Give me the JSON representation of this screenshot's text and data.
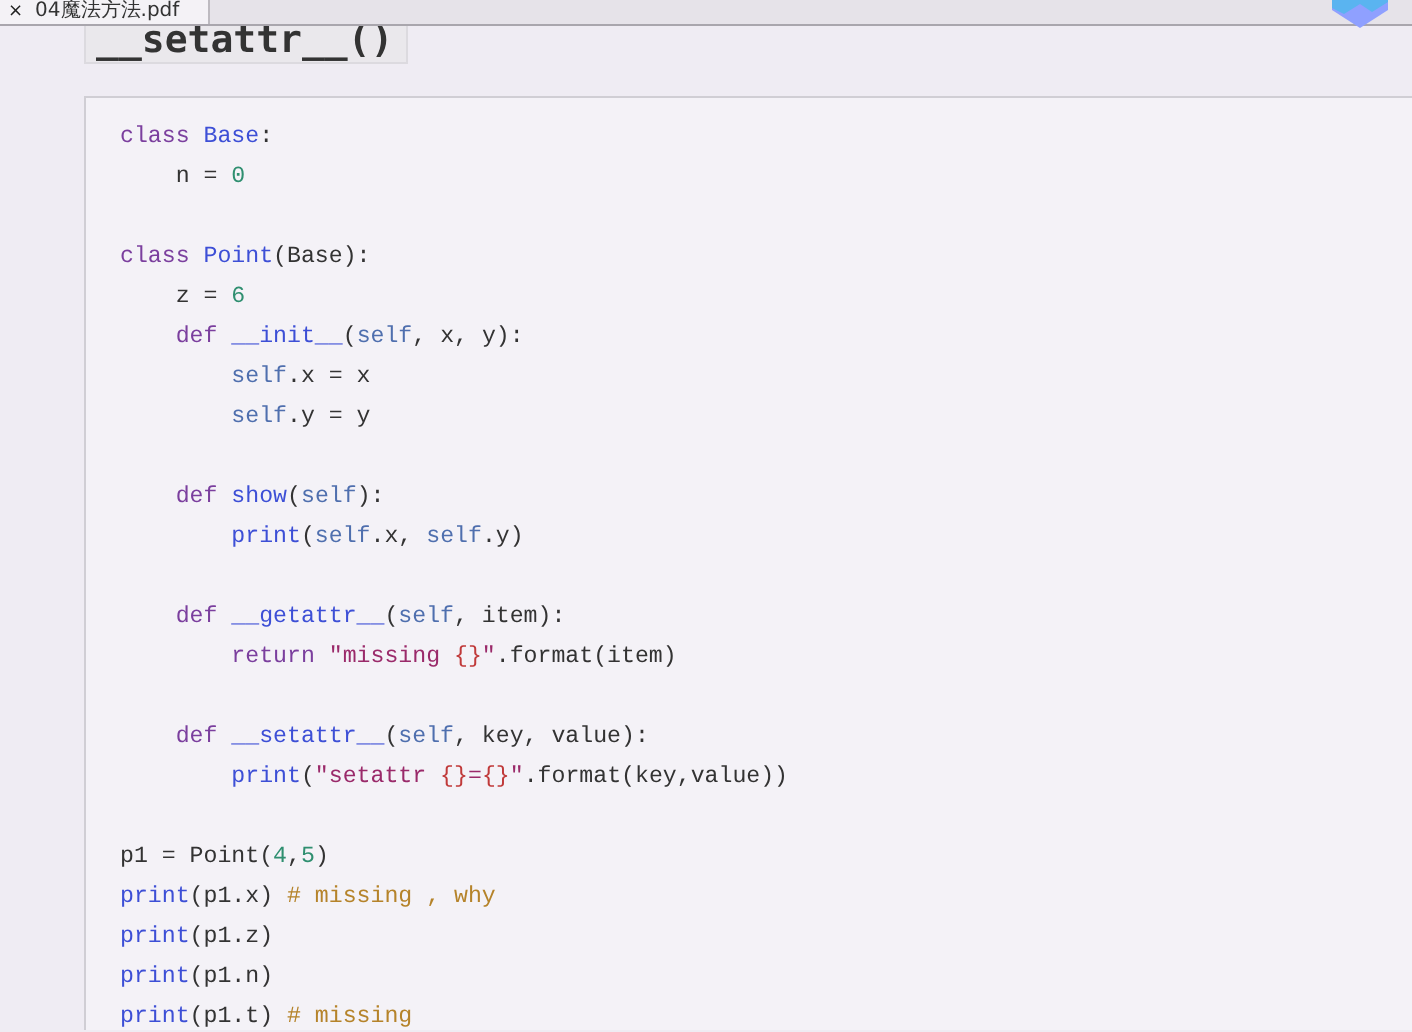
{
  "tab": {
    "close": "×",
    "label": "04魔法方法.pdf"
  },
  "heading": "__setattr__()",
  "code_blocks": [
    [
      [
        {
          "t": "class ",
          "kind": "kw"
        },
        {
          "t": "Base",
          "kind": "cls"
        },
        {
          "t": ":",
          "kind": "p"
        }
      ],
      [
        {
          "t": "    n = ",
          "kind": "p"
        },
        {
          "t": "0",
          "kind": "num"
        }
      ]
    ],
    [
      [
        {
          "t": "class ",
          "kind": "kw"
        },
        {
          "t": "Point",
          "kind": "cls"
        },
        {
          "t": "(Base):",
          "kind": "p"
        }
      ],
      [
        {
          "t": "    z = ",
          "kind": "p"
        },
        {
          "t": "6",
          "kind": "num"
        }
      ],
      [
        {
          "t": "    def ",
          "kind": "kw"
        },
        {
          "t": "__init__",
          "kind": "fn"
        },
        {
          "t": "(",
          "kind": "p"
        },
        {
          "t": "self",
          "kind": "self"
        },
        {
          "t": ", x, y):",
          "kind": "p"
        }
      ],
      [
        {
          "t": "        self",
          "kind": "self"
        },
        {
          "t": ".x = x",
          "kind": "p"
        }
      ],
      [
        {
          "t": "        self",
          "kind": "self"
        },
        {
          "t": ".y = y",
          "kind": "p"
        }
      ]
    ],
    [
      [
        {
          "t": "    def ",
          "kind": "kw"
        },
        {
          "t": "show",
          "kind": "fn"
        },
        {
          "t": "(",
          "kind": "p"
        },
        {
          "t": "self",
          "kind": "self"
        },
        {
          "t": "):",
          "kind": "p"
        }
      ],
      [
        {
          "t": "        print",
          "kind": "fn"
        },
        {
          "t": "(",
          "kind": "p"
        },
        {
          "t": "self",
          "kind": "self"
        },
        {
          "t": ".x, ",
          "kind": "p"
        },
        {
          "t": "self",
          "kind": "self"
        },
        {
          "t": ".y)",
          "kind": "p"
        }
      ]
    ],
    [
      [
        {
          "t": "    def ",
          "kind": "kw"
        },
        {
          "t": "__getattr__",
          "kind": "fn"
        },
        {
          "t": "(",
          "kind": "p"
        },
        {
          "t": "self",
          "kind": "self"
        },
        {
          "t": ", item):",
          "kind": "p"
        }
      ],
      [
        {
          "t": "        return ",
          "kind": "kw"
        },
        {
          "t": "\"missing ",
          "kind": "str"
        },
        {
          "t": "{}",
          "kind": "brace"
        },
        {
          "t": "\"",
          "kind": "str"
        },
        {
          "t": ".format(item)",
          "kind": "p"
        }
      ]
    ],
    [
      [
        {
          "t": "    def ",
          "kind": "kw"
        },
        {
          "t": "__setattr__",
          "kind": "fn"
        },
        {
          "t": "(",
          "kind": "p"
        },
        {
          "t": "self",
          "kind": "self"
        },
        {
          "t": ", key, value):",
          "kind": "p"
        }
      ],
      [
        {
          "t": "        print",
          "kind": "fn"
        },
        {
          "t": "(",
          "kind": "p"
        },
        {
          "t": "\"setattr ",
          "kind": "str"
        },
        {
          "t": "{}",
          "kind": "brace"
        },
        {
          "t": "=",
          "kind": "str"
        },
        {
          "t": "{}",
          "kind": "brace"
        },
        {
          "t": "\"",
          "kind": "str"
        },
        {
          "t": ".format(key,value))",
          "kind": "p"
        }
      ]
    ],
    [
      [
        {
          "t": "p1 = Point(",
          "kind": "p"
        },
        {
          "t": "4",
          "kind": "num"
        },
        {
          "t": ",",
          "kind": "p"
        },
        {
          "t": "5",
          "kind": "num"
        },
        {
          "t": ")",
          "kind": "p"
        }
      ],
      [
        {
          "t": "print",
          "kind": "fn"
        },
        {
          "t": "(p1.x) ",
          "kind": "p"
        },
        {
          "t": "# missing , why",
          "kind": "cmt"
        }
      ],
      [
        {
          "t": "print",
          "kind": "fn"
        },
        {
          "t": "(p1.z)",
          "kind": "p"
        }
      ],
      [
        {
          "t": "print",
          "kind": "fn"
        },
        {
          "t": "(p1.n)",
          "kind": "p"
        }
      ],
      [
        {
          "t": "print",
          "kind": "fn"
        },
        {
          "t": "(p1.t) ",
          "kind": "p"
        },
        {
          "t": "# missing",
          "kind": "cmt"
        }
      ]
    ]
  ]
}
